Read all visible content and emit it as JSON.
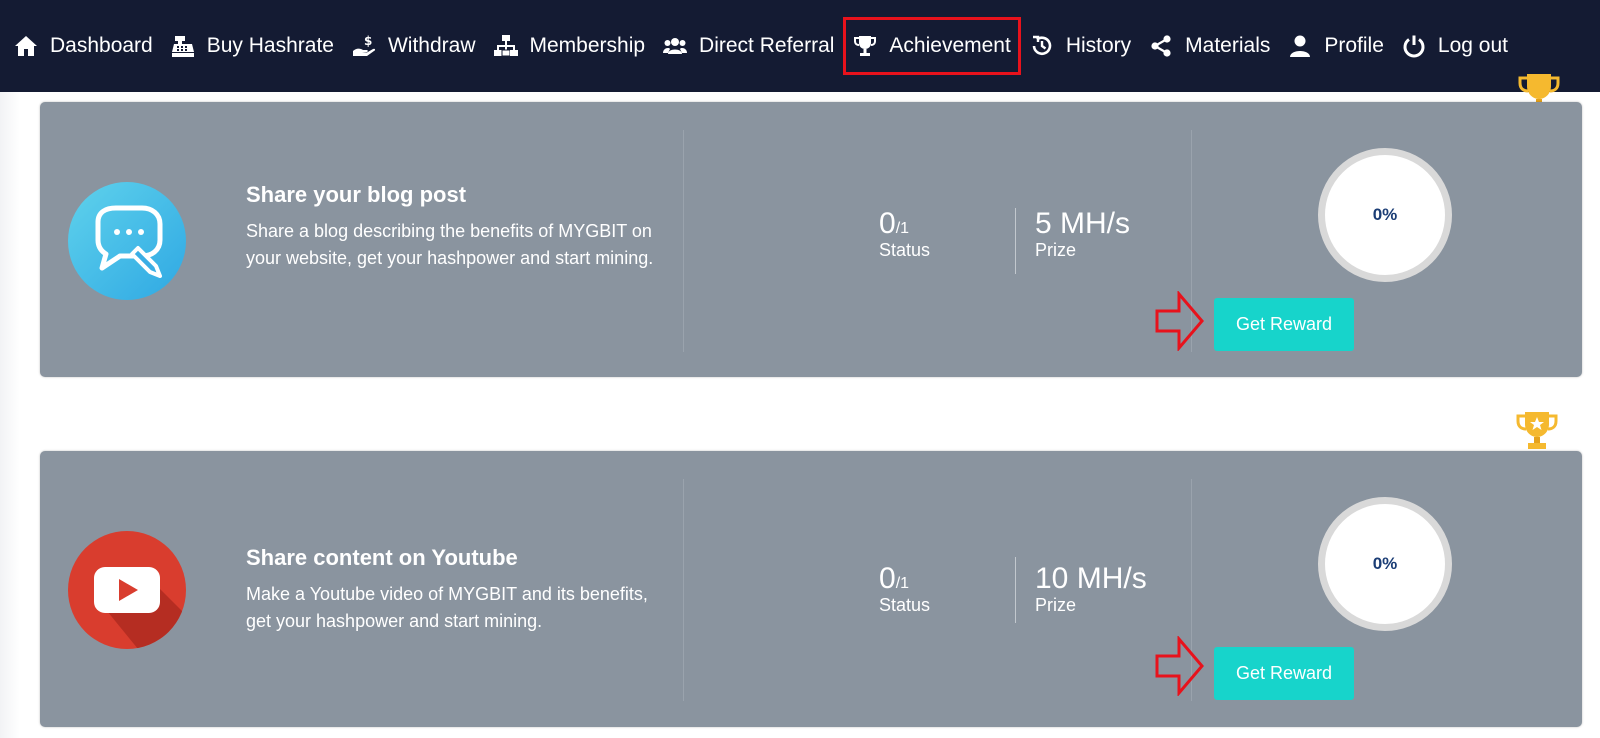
{
  "nav": {
    "items": [
      {
        "label": "Dashboard",
        "icon": "home-icon"
      },
      {
        "label": "Buy Hashrate",
        "icon": "cash-register-icon"
      },
      {
        "label": "Withdraw",
        "icon": "hand-dollar-icon"
      },
      {
        "label": "Membership",
        "icon": "sitemap-icon"
      },
      {
        "label": "Direct Referral",
        "icon": "users-icon"
      },
      {
        "label": "Achievement",
        "icon": "trophy-icon"
      },
      {
        "label": "History",
        "icon": "history-icon"
      },
      {
        "label": "Materials",
        "icon": "share-icon"
      },
      {
        "label": "Profile",
        "icon": "user-icon"
      },
      {
        "label": "Log out",
        "icon": "power-icon"
      }
    ],
    "highlighted": "Achievement",
    "colors": {
      "background": "#141b33",
      "highlight_border": "#e8121c"
    }
  },
  "achievements": [
    {
      "title": "Share your blog post",
      "description": "Share a blog describing the benefits of MYGBIT on your website, get your hashpower and start mining.",
      "icon": "chat-edit-icon",
      "status_value": "0",
      "status_total": "/1",
      "status_label": "Status",
      "prize_value": "5 MH/s",
      "prize_label": "Prize",
      "progress": "0%",
      "button_label": "Get Reward"
    },
    {
      "title": "Share content on Youtube",
      "description": "Make a Youtube video of MYGBIT and its benefits, get your hashpower and start mining.",
      "icon": "youtube-icon",
      "status_value": "0",
      "status_total": "/1",
      "status_label": "Status",
      "prize_value": "10 MH/s",
      "prize_label": "Prize",
      "progress": "0%",
      "button_label": "Get Reward"
    }
  ],
  "colors": {
    "card_background": "#8a949f",
    "button": "#17d4cb",
    "progress_text": "#1b3d75",
    "annotation_arrow": "#e8121c",
    "trophy": "#f5b92f"
  }
}
